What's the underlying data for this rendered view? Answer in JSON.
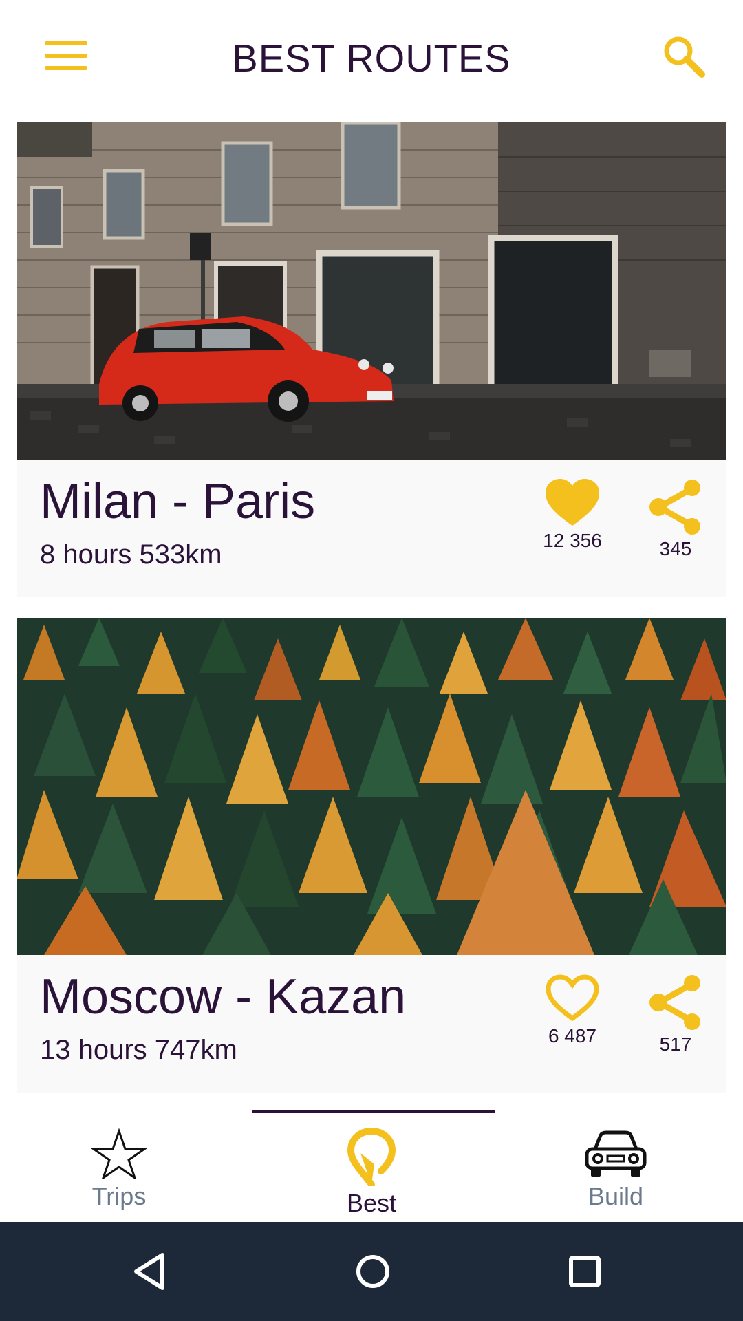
{
  "header": {
    "title": "BEST ROUTES",
    "menu_icon": "hamburger-menu-icon",
    "search_icon": "search-icon"
  },
  "colors": {
    "accent": "#f4c01e",
    "text": "#2a1238",
    "muted": "#6b7a8c",
    "card_bg": "#f9f9f9",
    "system_bar": "#1d2839"
  },
  "routes": [
    {
      "title": "Milan - Paris",
      "details": "8 hours 533km",
      "likes": "12 356",
      "liked": true,
      "shares": "345",
      "photo": "red vintage car parked by stone building"
    },
    {
      "title": "Moscow - Kazan",
      "details": "13 hours 747km",
      "likes": "6 487",
      "liked": false,
      "shares": "517",
      "photo": "autumn larch and pine forest"
    }
  ],
  "bottom_nav": {
    "items": [
      {
        "label": "Trips",
        "icon": "star-icon",
        "active": false
      },
      {
        "label": "Best",
        "icon": "route-pin-icon",
        "active": true
      },
      {
        "label": "Build",
        "icon": "car-icon",
        "active": false
      }
    ]
  },
  "system_nav": {
    "back_icon": "back-triangle-icon",
    "home_icon": "home-circle-icon",
    "recent_icon": "recent-apps-square-icon"
  }
}
